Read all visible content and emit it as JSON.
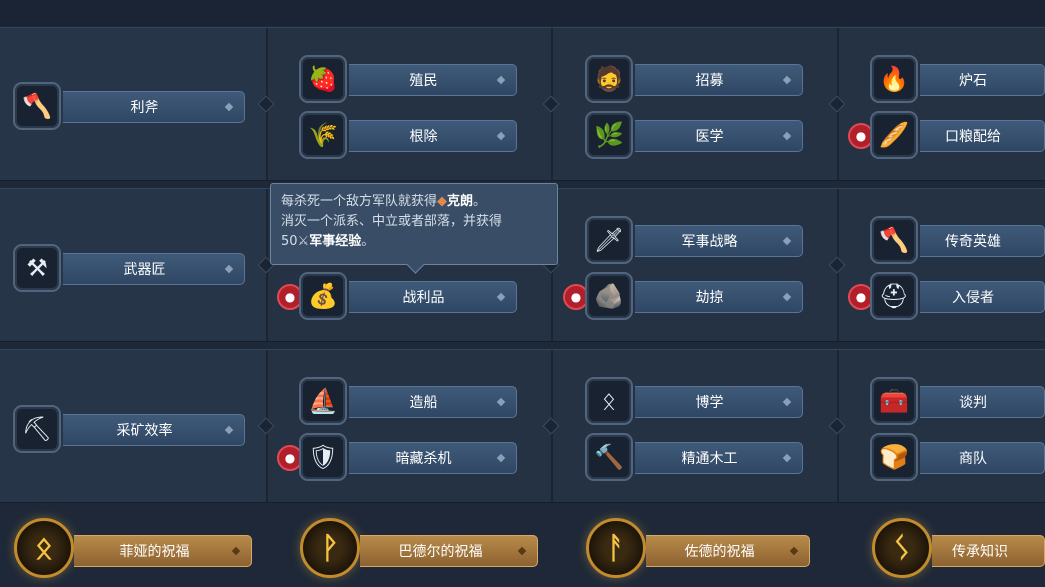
{
  "rows": [
    {
      "root": {
        "label": "利斧",
        "icon": "axe-log-icon",
        "glyph": "🪓"
      },
      "cols": [
        [
          {
            "label": "殖民",
            "icon": "berry-basket-icon",
            "glyph": "🍓",
            "badge": false
          },
          {
            "label": "根除",
            "icon": "grain-sacks-icon",
            "glyph": "🌾",
            "badge": false
          }
        ],
        [
          {
            "label": "招募",
            "icon": "bearded-man-icon",
            "glyph": "🧔",
            "badge": false
          },
          {
            "label": "医学",
            "icon": "herb-leaves-icon",
            "glyph": "🌿",
            "badge": false
          }
        ],
        [
          {
            "label": "炉石",
            "icon": "campfire-icon",
            "glyph": "🔥",
            "badge": false
          },
          {
            "label": "口粮配给",
            "icon": "food-sack-icon",
            "glyph": "🥖",
            "badge": true
          }
        ]
      ]
    },
    {
      "root": {
        "label": "武器匠",
        "icon": "anvil-icon",
        "glyph": "⚒"
      },
      "cols": [
        [
          {
            "label": "战利品",
            "icon": "loot-bag-icon",
            "glyph": "💰",
            "badge": true
          }
        ],
        [
          {
            "label": "军事战略",
            "icon": "sword-icon",
            "glyph": "🗡",
            "badge": false
          },
          {
            "label": "劫掠",
            "icon": "plunder-pile-icon",
            "glyph": "🪨",
            "badge": true
          }
        ],
        [
          {
            "label": "传奇英雄",
            "icon": "battle-axe-icon",
            "glyph": "🪓",
            "badge": false
          },
          {
            "label": "入侵者",
            "icon": "horned-helmet-icon",
            "glyph": "⛑",
            "badge": true
          }
        ]
      ]
    },
    {
      "root": {
        "label": "采矿效率",
        "icon": "pickaxe-icon",
        "glyph": "⛏"
      },
      "cols": [
        [
          {
            "label": "造船",
            "icon": "striped-sail-icon",
            "glyph": "⛵",
            "badge": false
          },
          {
            "label": "暗藏杀机",
            "icon": "banner-shield-icon",
            "glyph": "🛡",
            "badge": true
          }
        ],
        [
          {
            "label": "博学",
            "icon": "rune-stone-icon",
            "glyph": "ᛟ",
            "badge": false
          },
          {
            "label": "精通木工",
            "icon": "hammer-icon",
            "glyph": "🔨",
            "badge": false
          }
        ],
        [
          {
            "label": "谈判",
            "icon": "treasure-chest-icon",
            "glyph": "🧰",
            "badge": false
          },
          {
            "label": "商队",
            "icon": "trade-goods-icon",
            "glyph": "🍞",
            "badge": false
          }
        ]
      ]
    }
  ],
  "tooltip": {
    "line1_a": "每杀死一个敌方军队就获得",
    "line1_b": "克朗",
    "line1_c": "。",
    "line2": "消灭一个派系、中立或者部落，并获得",
    "line3_a": "50",
    "line3_b": "军事经验",
    "line3_c": "。",
    "crown_icon": "crown-coin-icon",
    "sword_icon": "crossed-swords-icon"
  },
  "blessings": [
    {
      "label": "菲娅的祝福",
      "icon": "rune-othala-icon",
      "glyph": "ᛟ"
    },
    {
      "label": "巴德尔的祝福",
      "icon": "rune-wunjo-icon",
      "glyph": "ᚹ"
    },
    {
      "label": "佐德的祝福",
      "icon": "rune-ansuz-icon",
      "glyph": "ᚨ"
    },
    {
      "label": "传承知识",
      "icon": "rune-sowilo-icon",
      "glyph": "ᛊ"
    }
  ],
  "colors": {
    "accent_gold": "#c28c2c",
    "label_blue": "#3f5a79",
    "badge_red": "#b01f2a"
  }
}
